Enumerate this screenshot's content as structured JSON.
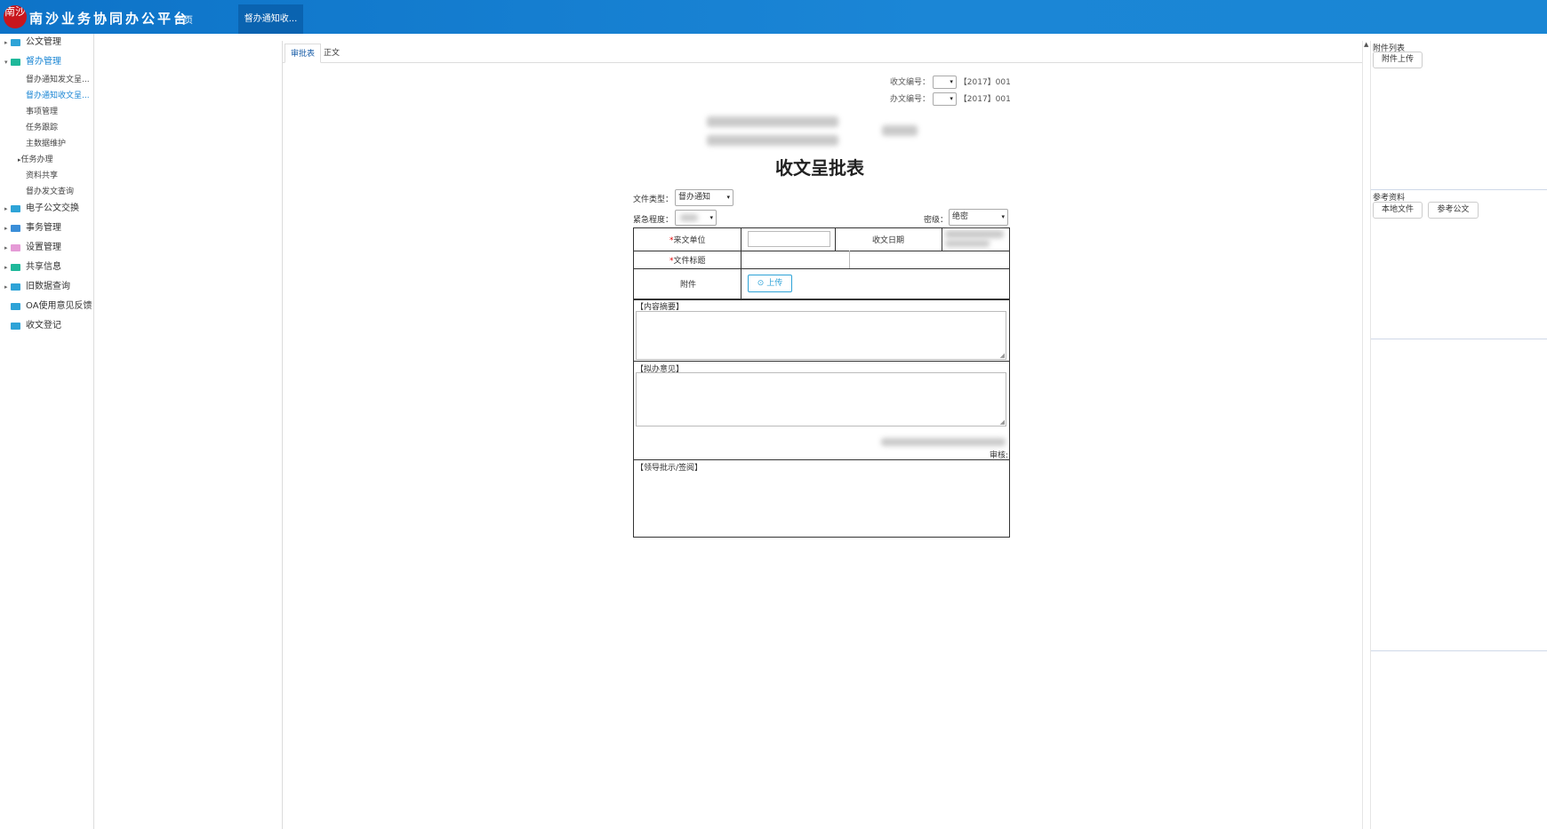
{
  "header": {
    "seal_text": "南沙",
    "app_title": "南沙业务协同办公平台",
    "home_label": "主页",
    "active_tab_label": "督办通知收..."
  },
  "sidebar": {
    "items": [
      {
        "label": "公文管理",
        "color": "#2ea3d7"
      },
      {
        "label": "督办管理",
        "color": "#1fb89a"
      },
      {
        "label": "电子公文交换",
        "color": "#2ea3d7"
      },
      {
        "label": "事务管理",
        "color": "#3a8ed8"
      },
      {
        "label": "设置管理",
        "color": "#e59ad6"
      },
      {
        "label": "共享信息",
        "color": "#1fb89a"
      },
      {
        "label": "旧数据查询",
        "color": "#2ea3d7"
      },
      {
        "label": "OA使用意见反馈",
        "color": "#2ea3d7"
      },
      {
        "label": "收文登记",
        "color": "#2ea3d7"
      }
    ],
    "sub_items": [
      "督办通知发文呈...",
      "督办通知收文呈...",
      "事项管理",
      "任务跟踪",
      "主数据维护",
      "任务办理",
      "资料共享",
      "督办发文查询"
    ]
  },
  "tabs": [
    "审批表",
    "正文"
  ],
  "form": {
    "receive_no_label": "收文编号：",
    "receive_no_value": "【2017】001",
    "handle_no_label": "办文编号：",
    "handle_no_value": "【2017】001",
    "title": "收文呈批表",
    "file_type_label": "文件类型：",
    "file_type_value": "督办通知",
    "urgency_label": "紧急程度：",
    "secrecy_label": "密级：",
    "secrecy_value": "绝密",
    "source_unit_label": "来文单位",
    "receive_date_label": "收文日期",
    "file_title_label": "文件标题",
    "attachment_label": "附件",
    "upload_label": "⊙ 上传",
    "summary_label": "【内容摘要】",
    "opinion_label": "【拟办意见】",
    "review_label": "审核:",
    "leader_label": "【领导批示/签阅】",
    "required_mark": "*"
  },
  "right_panel": {
    "attachments_title": "附件列表",
    "attachment_upload_btn": "附件上传",
    "reference_title": "参考资料",
    "local_file_btn": "本地文件",
    "reference_doc_btn": "参考公文"
  }
}
